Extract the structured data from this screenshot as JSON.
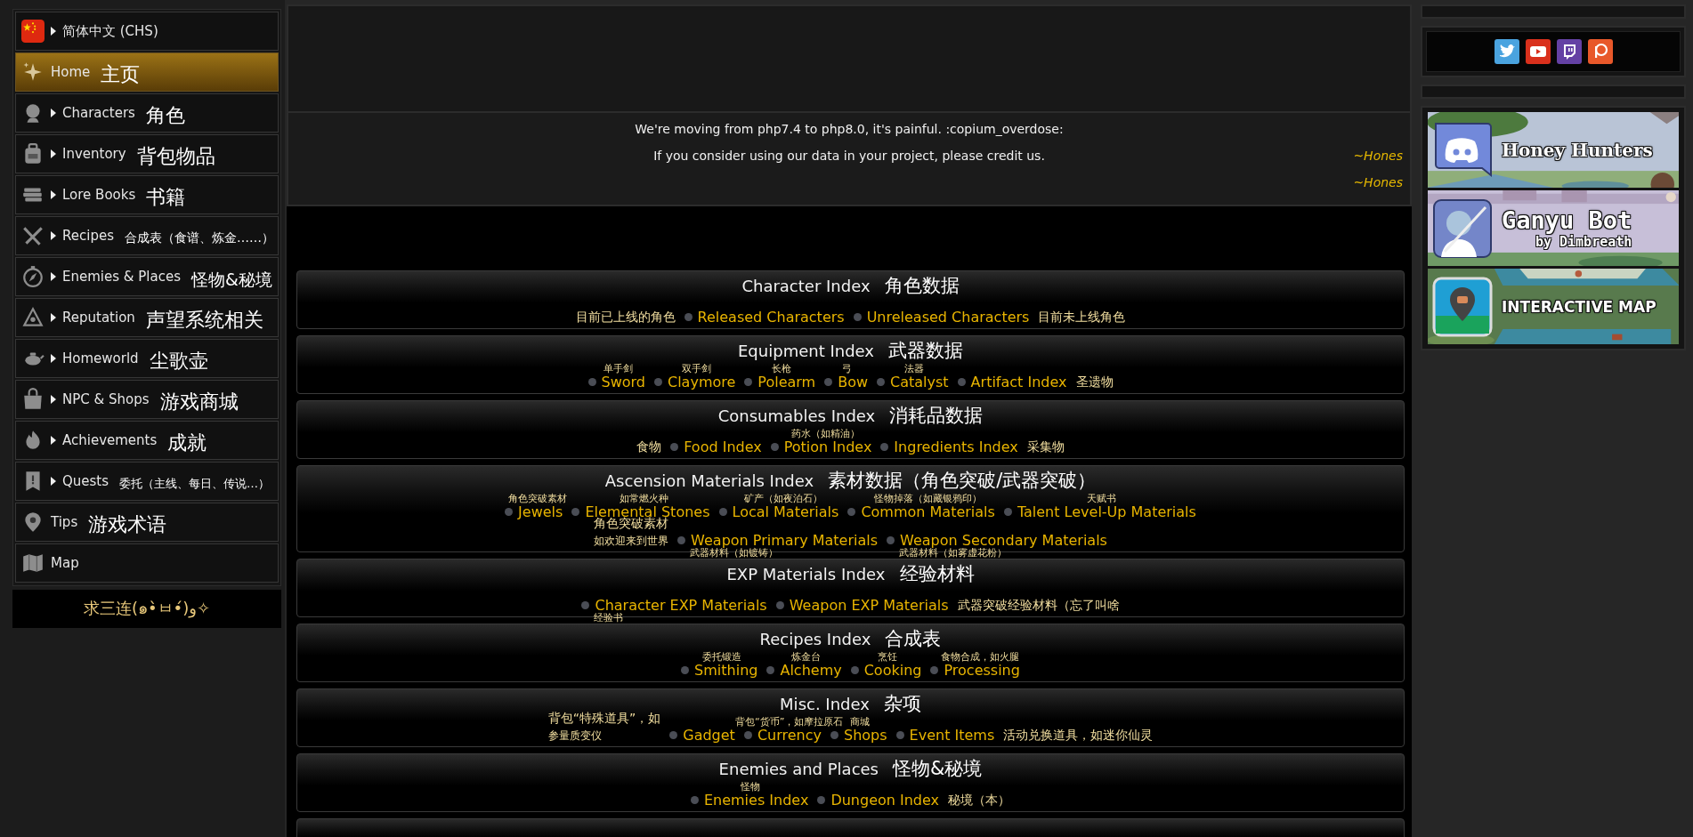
{
  "sidebar": {
    "items": [
      {
        "label": "简体中文 (CHS)",
        "expandable": true,
        "selected": false
      },
      {
        "label": "Home",
        "note": "主页",
        "expandable": false,
        "selected": true
      },
      {
        "label": "Characters",
        "note": "角色",
        "expandable": true,
        "selected": false
      },
      {
        "label": "Inventory",
        "note": "背包物品",
        "expandable": true,
        "selected": false
      },
      {
        "label": "Lore Books",
        "note": "书籍",
        "expandable": true,
        "selected": false
      },
      {
        "label": "Recipes",
        "note": "合成表（食谱、炼金……）",
        "expandable": true,
        "selected": false
      },
      {
        "label": "Enemies & Places",
        "note": "怪物&秘境",
        "expandable": true,
        "selected": false
      },
      {
        "label": "Reputation",
        "note": "声望系统相关",
        "expandable": true,
        "selected": false
      },
      {
        "label": "Homeworld",
        "note": "尘歌壶",
        "expandable": true,
        "selected": false
      },
      {
        "label": "NPC & Shops",
        "note": "游戏商城",
        "expandable": true,
        "selected": false
      },
      {
        "label": "Achievements",
        "note": "成就",
        "expandable": true,
        "selected": false
      },
      {
        "label": "Quests",
        "note": "委托（主线、每日、传说…）",
        "expandable": true,
        "selected": false
      },
      {
        "label": "Tips",
        "note": "游戏术语",
        "expandable": false,
        "selected": false
      },
      {
        "label": "Map",
        "expandable": false,
        "selected": false
      }
    ],
    "footer": "求三连(๑•̀ㅂ•́)و✧"
  },
  "notice": {
    "messages": [
      {
        "text": "We're moving from php7.4 to php8.0, it's painful. :copium_overdose:",
        "author": "~Hones"
      },
      {
        "text": "If you consider using our data in your project, please credit us.",
        "author": "~Hones"
      }
    ]
  },
  "sections": [
    {
      "title": "Character Index",
      "note": "角色数据",
      "rows": [
        [
          {
            "kind": "note",
            "text": "目前已上线的角色"
          },
          {
            "kind": "link",
            "label": "Released Characters"
          },
          {
            "kind": "link",
            "label": "Unreleased Characters"
          },
          {
            "kind": "note",
            "text": "目前未上线角色"
          }
        ]
      ]
    },
    {
      "title": "Equipment Index",
      "note": "武器数据",
      "rows": [
        [
          {
            "kind": "link",
            "label": "Sword",
            "note": "单手剑"
          },
          {
            "kind": "link",
            "label": "Claymore",
            "note": "双手剑"
          },
          {
            "kind": "link",
            "label": "Polearm",
            "note": "长枪"
          },
          {
            "kind": "link",
            "label": "Bow",
            "note": "弓"
          },
          {
            "kind": "link",
            "label": "Catalyst",
            "note": "法器"
          },
          {
            "kind": "link",
            "label": "Artifact Index"
          },
          {
            "kind": "note",
            "text": "圣遗物"
          }
        ]
      ]
    },
    {
      "title": "Consumables Index",
      "note": "消耗品数据",
      "rows": [
        [
          {
            "kind": "note",
            "text": "食物"
          },
          {
            "kind": "link",
            "label": "Food Index"
          },
          {
            "kind": "link",
            "label": "Potion Index",
            "note": "药水（如精油）"
          },
          {
            "kind": "link",
            "label": "Ingredients Index"
          },
          {
            "kind": "note",
            "text": "采集物"
          }
        ]
      ]
    },
    {
      "title": "Ascension Materials Index",
      "note": "素材数据（角色突破/武器突破）",
      "rows": [
        [
          {
            "kind": "link",
            "label": "Jewels",
            "note": "角色突破素材"
          },
          {
            "kind": "link",
            "label": "Elemental Stones",
            "note": "如常燃火种"
          },
          {
            "kind": "link",
            "label": "Local Materials",
            "note": "矿产（如夜泊石）"
          },
          {
            "kind": "link",
            "label": "Common Materials",
            "note": "怪物掉落（如藏银鸦印）"
          },
          {
            "kind": "link",
            "label": "Talent Level-Up Materials",
            "note": "天赋书"
          },
          {
            "kind": "wrap"
          },
          {
            "kind": "note",
            "text": "角色突破素材",
            "sub": "如欢迎来到世界"
          },
          {
            "kind": "link",
            "label": "Weapon Primary Materials",
            "note_below": "武器材料（如镀铸）"
          },
          {
            "kind": "link",
            "label": "Weapon Secondary Materials",
            "note_below": "武器材料（如雾虚花粉）"
          }
        ]
      ]
    },
    {
      "title": "EXP Materials Index",
      "note": "经验材料",
      "rows": [
        [
          {
            "kind": "link",
            "label": "Character EXP Materials",
            "note_below": "经验书"
          },
          {
            "kind": "link",
            "label": "Weapon EXP Materials"
          },
          {
            "kind": "note",
            "text": "武器突破经验材料（忘了叫啥"
          }
        ]
      ]
    },
    {
      "title": "Recipes Index",
      "note": "合成表",
      "rows": [
        [
          {
            "kind": "link",
            "label": "Smithing",
            "note": "委托锻造"
          },
          {
            "kind": "link",
            "label": "Alchemy",
            "note": "炼金台"
          },
          {
            "kind": "link",
            "label": "Cooking",
            "note": "烹饪"
          },
          {
            "kind": "link",
            "label": "Processing",
            "note": "食物合成，如火腿"
          }
        ]
      ]
    },
    {
      "title": "Misc. Index",
      "note": "杂项",
      "rows": [
        [
          {
            "kind": "note",
            "text": "背包“特殊道具”，如",
            "sub": "参量质变仪"
          },
          {
            "kind": "link",
            "label": "Gadget"
          },
          {
            "kind": "link",
            "label": "Currency",
            "note": "背包“货币”，如摩拉原石"
          },
          {
            "kind": "link",
            "label": "Shops",
            "note": "商城"
          },
          {
            "kind": "link",
            "label": "Event Items"
          },
          {
            "kind": "note",
            "text": "活动兑换道具，如迷你仙灵"
          }
        ]
      ]
    },
    {
      "title": "Enemies and Places",
      "note": "怪物&秘境",
      "rows": [
        [
          {
            "kind": "link",
            "label": "Enemies Index",
            "note": "怪物"
          },
          {
            "kind": "link",
            "label": "Dungeon Index"
          },
          {
            "kind": "note",
            "text": "秘境（本）"
          }
        ]
      ]
    }
  ],
  "more_sections_below": true,
  "banners": [
    {
      "title": "Honey Hunters"
    },
    {
      "title": "Ganyu Bot",
      "subtitle": "by Dimbreath"
    },
    {
      "title": "INTERACTIVE MAP"
    }
  ]
}
